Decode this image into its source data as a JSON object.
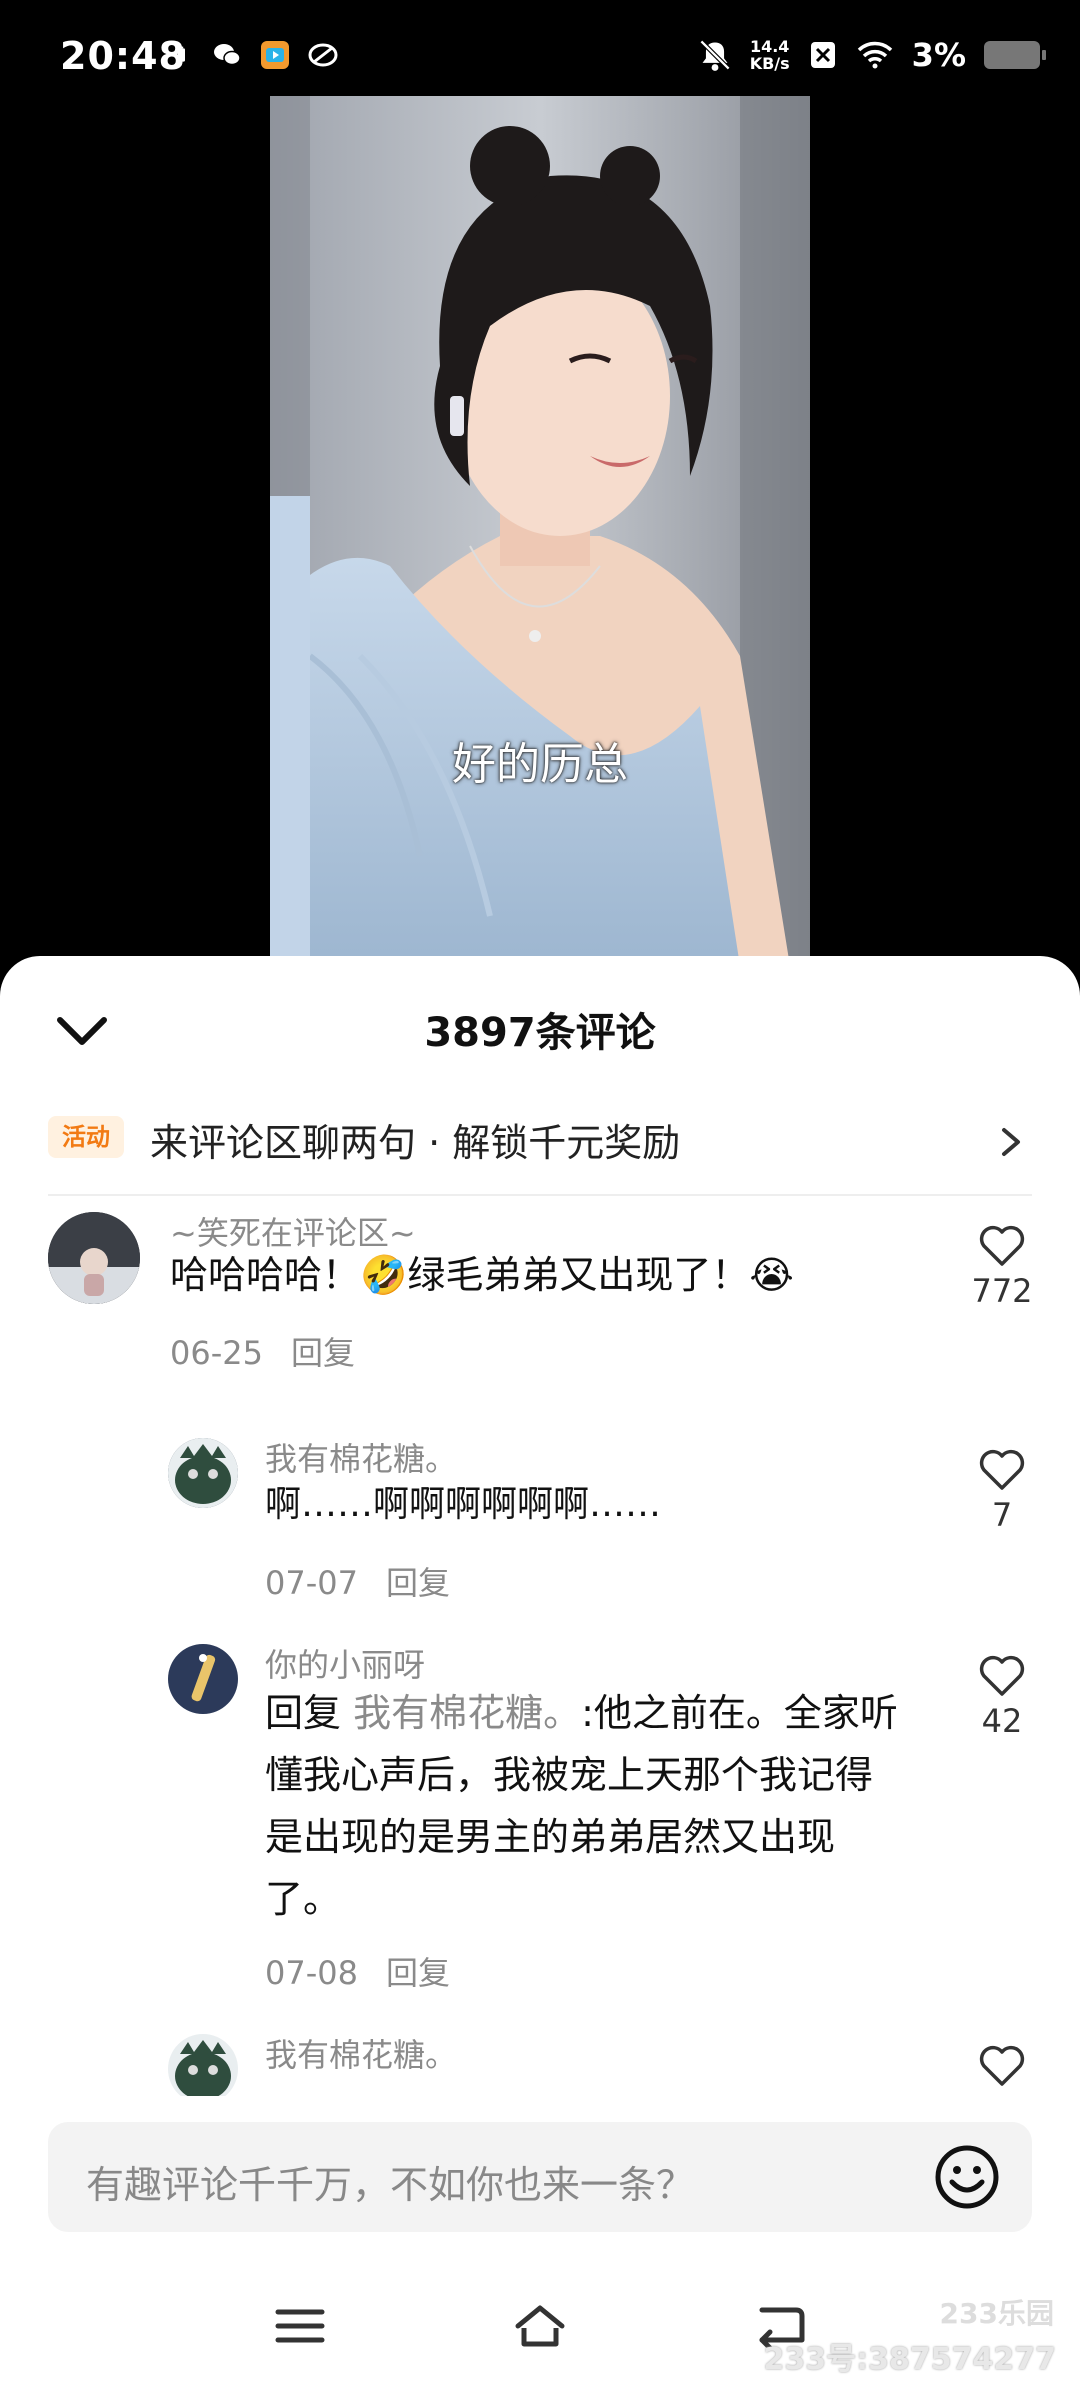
{
  "status_bar": {
    "time": "20:48",
    "net_speed_value": "14.4",
    "net_speed_unit": "KB/s",
    "battery_percent": "3%",
    "icons": [
      "battery-small-icon",
      "wechat-icon",
      "video-app-icon",
      "game-app-icon",
      "mute-icon",
      "no-sim-icon",
      "wifi-icon",
      "battery-icon"
    ]
  },
  "video": {
    "subtitle": "好的历总"
  },
  "sheet": {
    "comment_count": "3897条评论"
  },
  "promo": {
    "badge": "活动",
    "text": "来评论区聊两句 · 解锁千元奖励"
  },
  "comments": [
    {
      "user": "~笑死在评论区~",
      "text": "哈哈哈哈！🤣绿毛弟弟又出现了！😭",
      "date": "06-25",
      "reply_label": "回复",
      "likes": "772"
    },
    {
      "user": "我有棉花糖。",
      "text": "啊……啊啊啊啊啊啊……",
      "date": "07-07",
      "reply_label": "回复",
      "likes": "7"
    },
    {
      "user": "你的小丽呀",
      "reply_prefix": "回复",
      "reply_to": "我有棉花糖。",
      "text": ":他之前在。全家听懂我心声后，我被宠上天那个我记得是出现的是男主的弟弟居然又出现了。",
      "date": "07-08",
      "reply_label": "回复",
      "likes": "42"
    },
    {
      "user": "我有棉花糖。"
    }
  ],
  "input": {
    "placeholder": "有趣评论千千万，不如你也来一条？"
  },
  "nav": {
    "watermark_logo": "233乐园",
    "watermark": "233号:387574277"
  }
}
